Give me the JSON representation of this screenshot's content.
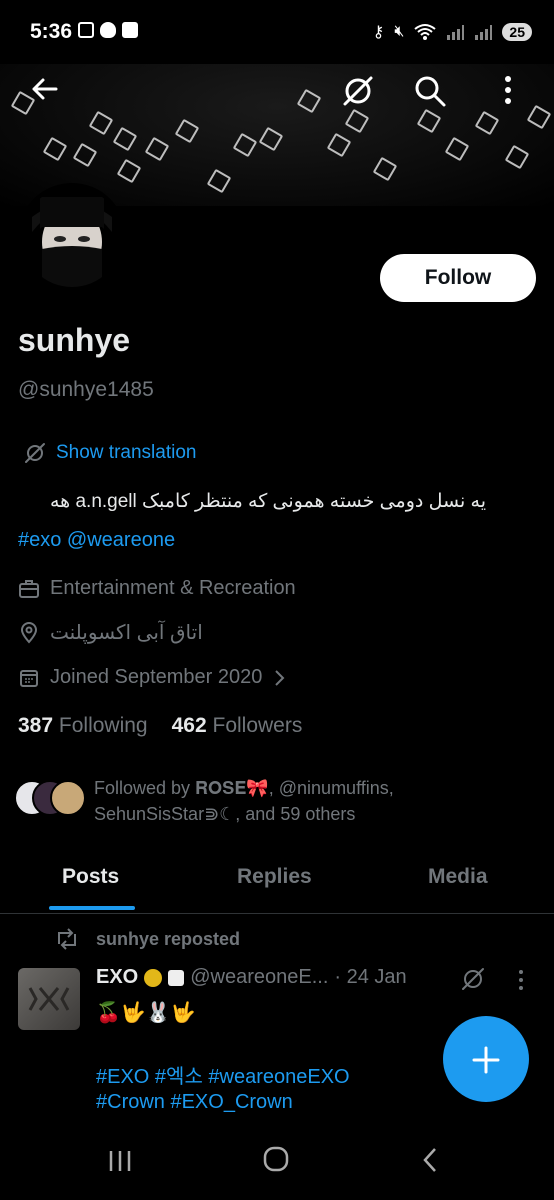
{
  "status_bar": {
    "time": "5:36",
    "battery": "25"
  },
  "header": {
    "back_icon": "arrow-left-icon",
    "grok_icon": "grok-icon",
    "search_icon": "search-icon",
    "more_icon": "more-vertical-icon"
  },
  "profile": {
    "follow_label": "Follow",
    "name": "sunhye",
    "handle": "@sunhye1485",
    "show_translation": "Show translation",
    "bio_line1": "یه نسل دومی خسته همونی که منتظر کامبک a.n.gell هه",
    "bio_line2": "#exo @weareone",
    "category": "Entertainment & Recreation",
    "location": "اتاق آبی اکسوپلنت",
    "joined": "Joined September 2020",
    "following_count": "387",
    "following_label": "Following",
    "followers_count": "462",
    "followers_label": "Followers",
    "followed_by_line1": "Followed by 𝐑𝐎𝐒𝐄🎀, @ninumuffins,",
    "followed_by_line2": "SehunSisStar⋑☾, and 59 others"
  },
  "tabs": [
    {
      "label": "Posts",
      "active": true
    },
    {
      "label": "Replies",
      "active": false
    },
    {
      "label": "Media",
      "active": false
    }
  ],
  "post": {
    "repost_label": "sunhye reposted",
    "author": "EXO",
    "handle": "@weareoneE...",
    "date": "· 24 Jan",
    "body": "🍒🤟🐰🤟",
    "tags_line1": "#EXO #엑소 #weareoneEXO",
    "tags_line2": "#Crown #EXO_Crown"
  },
  "colors": {
    "accent": "#1d9bf0",
    "text": "#e7e9ea",
    "muted": "#71767b",
    "background": "#000000"
  }
}
